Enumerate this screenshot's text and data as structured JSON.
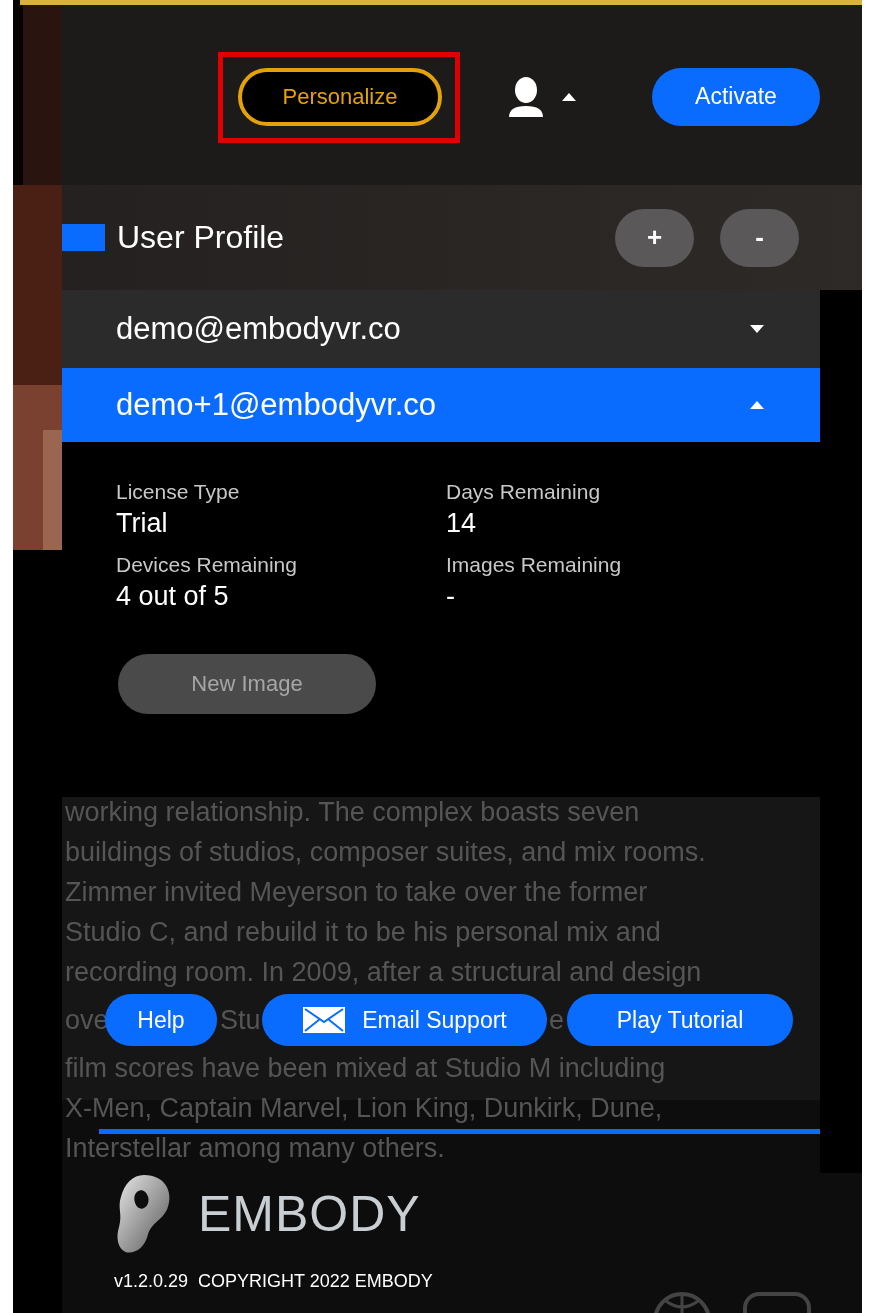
{
  "header": {
    "personalize": "Personalize",
    "activate": "Activate"
  },
  "profile": {
    "title": "User Profile",
    "add": "+",
    "remove": "-",
    "accounts": [
      {
        "email": "demo@embodyvr.co",
        "expanded": false
      },
      {
        "email": "demo+1@embodyvr.co",
        "expanded": true
      }
    ],
    "details": [
      {
        "label": "License Type",
        "value": "Trial"
      },
      {
        "label": "Days Remaining",
        "value": "14"
      },
      {
        "label": "Devices Remaining",
        "value": "4 out of 5"
      },
      {
        "label": "Images Remaining",
        "value": "-"
      }
    ],
    "new_image": {
      "label": "New Image",
      "disabled": true
    }
  },
  "background_text": {
    "lines": [
      "working relationship. The complex boasts seven",
      "buildings of studios, composer suites, and mix rooms.",
      "Zimmer invited Meyerson to take over the former",
      "Studio C, and rebuild it to be his personal mix and",
      "recording room. In 2009, after a structural and design"
    ],
    "covered_line": [
      "ove",
      "Stu",
      "e"
    ],
    "lines_after": [
      "film scores have been mixed at Studio M including",
      "X-Men, Captain Marvel, Lion King, Dunkirk, Dune,",
      "Interstellar among many others."
    ]
  },
  "actions": [
    {
      "label": "Help",
      "kind": "plain"
    },
    {
      "label": "Email Support",
      "kind": "email"
    },
    {
      "label": "Play Tutorial",
      "kind": "plain"
    }
  ],
  "footer": {
    "brand": "EMBODY",
    "version": "v1.2.0.29  COPYRIGHT 2022 EMBODY"
  }
}
